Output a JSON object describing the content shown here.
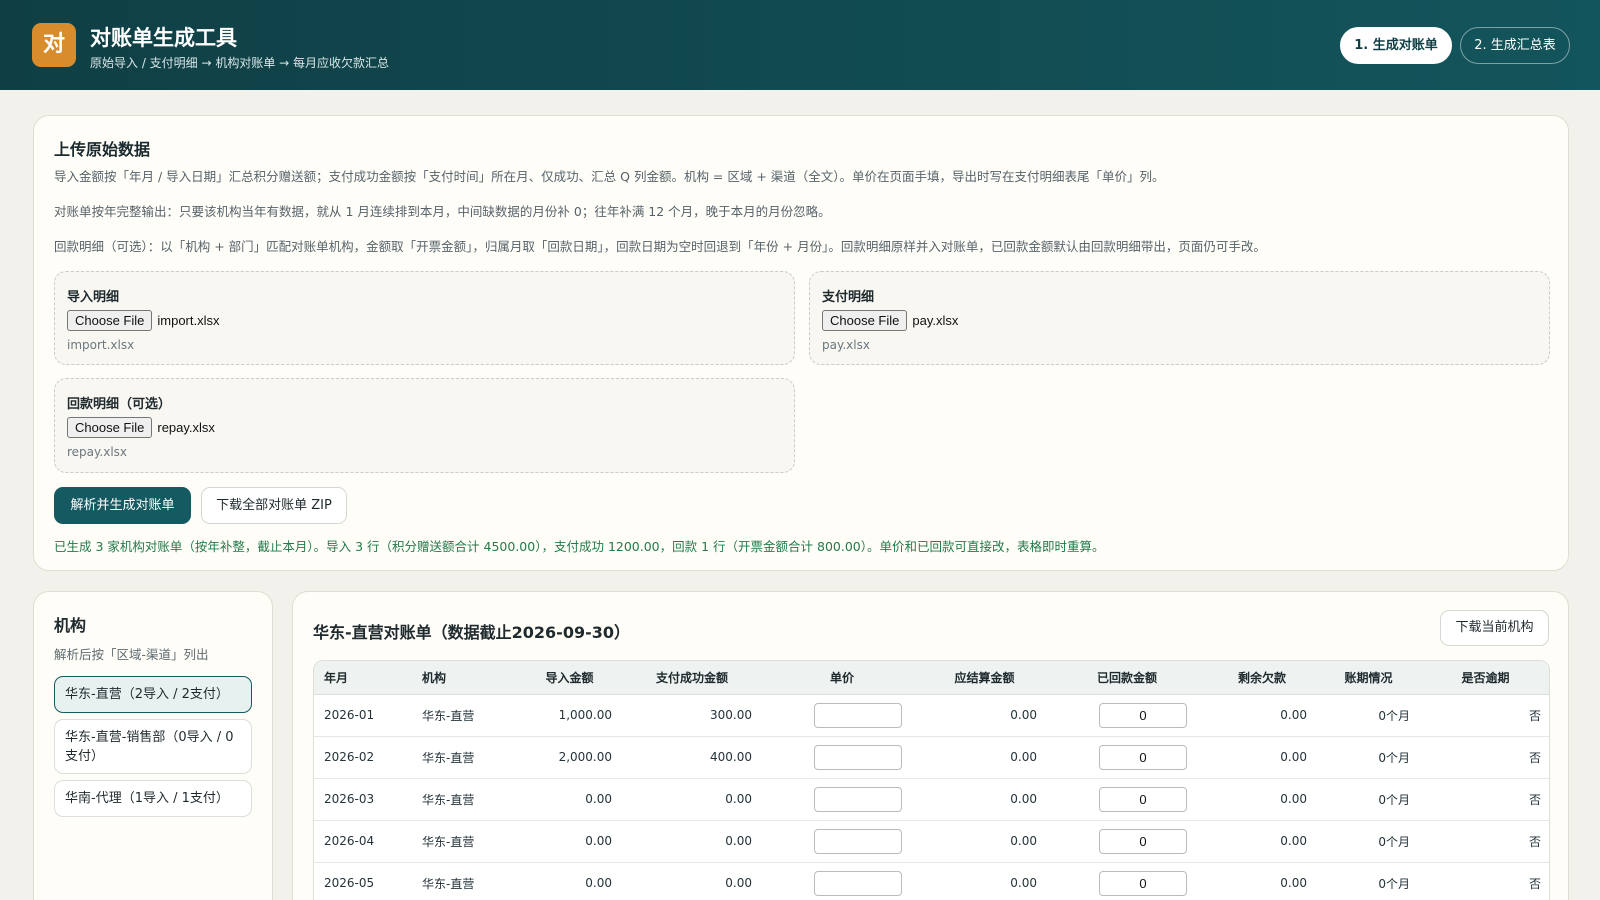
{
  "header": {
    "logo": "对",
    "title": "对账单生成工具",
    "subtitle": "原始导入 / 支付明细 → 机构对账单 → 每月应收欠款汇总",
    "steps": [
      "1. 生成对账单",
      "2. 生成汇总表"
    ]
  },
  "upload": {
    "title": "上传原始数据",
    "desc1": "导入金额按「年月 / 导入日期」汇总积分赠送额；支付成功金额按「支付时间」所在月、仅成功、汇总 Q 列金额。机构 = 区域 + 渠道（全文）。单价在页面手填，导出时写在支付明细表尾「单价」列。",
    "desc2": "对账单按年完整输出：只要该机构当年有数据，就从 1 月连续排到本月，中间缺数据的月份补 0；往年补满 12 个月，晚于本月的月份忽略。",
    "desc3": "回款明细（可选）：以「机构 + 部门」匹配对账单机构，金额取「开票金额」，归属月取「回款日期」，回款日期为空时回退到「年份 + 月份」。回款明细原样并入对账单，已回款金额默认由回款明细带出，页面仍可手改。",
    "import": {
      "label": "导入明细",
      "button": "Choose File",
      "file": "import.xlsx",
      "hint": "import.xlsx"
    },
    "pay": {
      "label": "支付明细",
      "button": "Choose File",
      "file": "pay.xlsx",
      "hint": "pay.xlsx"
    },
    "repay": {
      "label": "回款明细（可选）",
      "button": "Choose File",
      "file": "repay.xlsx",
      "hint": "repay.xlsx"
    },
    "generate_button": "解析并生成对账单",
    "download_all_button": "下载全部对账单 ZIP",
    "status": "已生成 3 家机构对账单（按年补整，截止本月）。导入 3 行（积分赠送额合计 4500.00），支付成功 1200.00，回款 1 行（开票金额合计 800.00）。单价和已回款可直接改，表格即时重算。"
  },
  "orgs": {
    "title": "机构",
    "subtitle": "解析后按「区域-渠道」列出",
    "items": [
      "华东-直营（2导入 / 2支付）",
      "华东-直营-销售部（0导入 / 0支付）",
      "华南-代理（1导入 / 1支付）"
    ]
  },
  "statement": {
    "title": "华东-直营对账单（数据截止2026-09-30）",
    "download_button": "下载当前机构",
    "columns": [
      "年月",
      "机构",
      "导入金额",
      "支付成功金额",
      "单价",
      "应结算金额",
      "已回款金额",
      "剩余欠款",
      "账期情况",
      "是否逾期"
    ],
    "rows": [
      {
        "month": "2026-01",
        "org": "华东-直营",
        "import": "1,000.00",
        "paid": "300.00",
        "price": "",
        "settle": "0.00",
        "repaid": "0",
        "owed": "0.00",
        "term": "0个月",
        "overdue": "否"
      },
      {
        "month": "2026-02",
        "org": "华东-直营",
        "import": "2,000.00",
        "paid": "400.00",
        "price": "",
        "settle": "0.00",
        "repaid": "0",
        "owed": "0.00",
        "term": "0个月",
        "overdue": "否"
      },
      {
        "month": "2026-03",
        "org": "华东-直营",
        "import": "0.00",
        "paid": "0.00",
        "price": "",
        "settle": "0.00",
        "repaid": "0",
        "owed": "0.00",
        "term": "0个月",
        "overdue": "否"
      },
      {
        "month": "2026-04",
        "org": "华东-直营",
        "import": "0.00",
        "paid": "0.00",
        "price": "",
        "settle": "0.00",
        "repaid": "0",
        "owed": "0.00",
        "term": "0个月",
        "overdue": "否"
      },
      {
        "month": "2026-05",
        "org": "华东-直营",
        "import": "0.00",
        "paid": "0.00",
        "price": "",
        "settle": "0.00",
        "repaid": "0",
        "owed": "0.00",
        "term": "0个月",
        "overdue": "否"
      }
    ]
  },
  "colors": {
    "header_bg": "#0f3f45",
    "logo_bg": "#d88c2c",
    "primary": "#145a60",
    "status_text": "#237a4a",
    "page_bg": "#f3f1ec"
  }
}
